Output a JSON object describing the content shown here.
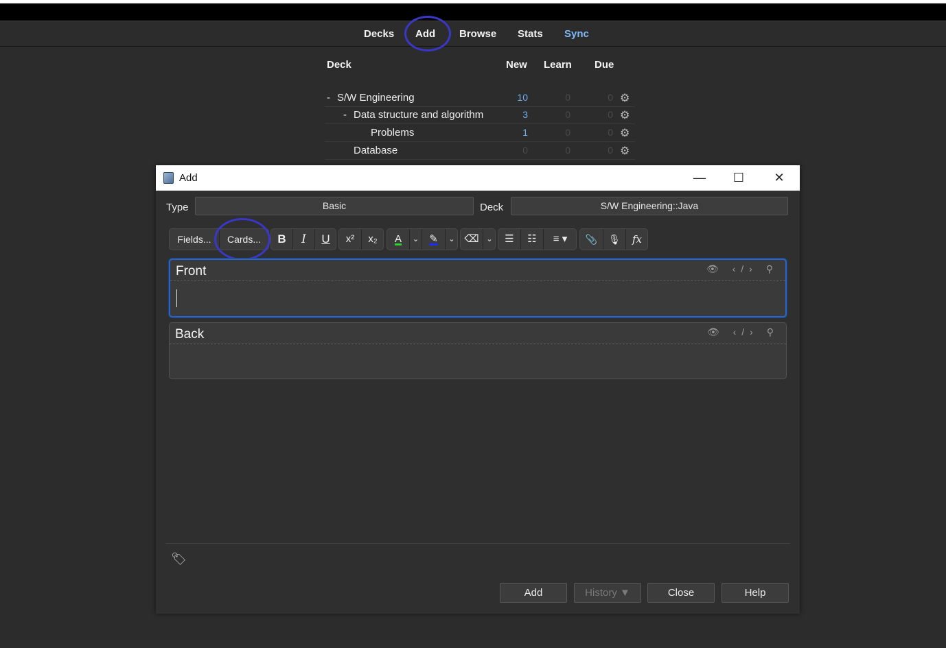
{
  "main_toolbar": {
    "decks": "Decks",
    "add": "Add",
    "browse": "Browse",
    "stats": "Stats",
    "sync": "Sync"
  },
  "deck_list": {
    "headers": {
      "deck": "Deck",
      "new": "New",
      "learn": "Learn",
      "due": "Due"
    },
    "rows": [
      {
        "toggle": "-",
        "name": "S/W Engineering",
        "new": "10",
        "learn": "0",
        "due": "0"
      },
      {
        "toggle": "-",
        "name": "Data structure and algorithm",
        "new": "3",
        "learn": "0",
        "due": "0"
      },
      {
        "toggle": "",
        "name": "Problems",
        "new": "1",
        "learn": "0",
        "due": "0"
      },
      {
        "toggle": "",
        "name": "Database",
        "new": "0",
        "learn": "0",
        "due": "0"
      }
    ]
  },
  "add_dialog": {
    "title": "Add",
    "window_controls": {
      "minimize": "—",
      "maximize": "☐",
      "close": "✕"
    },
    "type_label": "Type",
    "type_value": "Basic",
    "deck_label": "Deck",
    "deck_value": "S/W Engineering::Java",
    "toolbar": {
      "fields": "Fields...",
      "cards": "Cards...",
      "bold": "B",
      "italic": "I",
      "underline": "U",
      "superscript": "x²",
      "subscript": "x₂",
      "text_color": "A",
      "highlight": "✎",
      "eraser": "⌫",
      "bullet_list": "☰",
      "numbered_list": "☷",
      "align": "≡",
      "attach": "📎",
      "record": "🎙",
      "formula": "fx",
      "text_color_swatch": "#2bd12b",
      "highlight_swatch": "#1a2cff"
    },
    "fields": [
      {
        "label": "Front",
        "value": ""
      },
      {
        "label": "Back",
        "value": ""
      }
    ],
    "buttons": {
      "add": "Add",
      "history": "History ▼",
      "close": "Close",
      "help": "Help"
    }
  }
}
